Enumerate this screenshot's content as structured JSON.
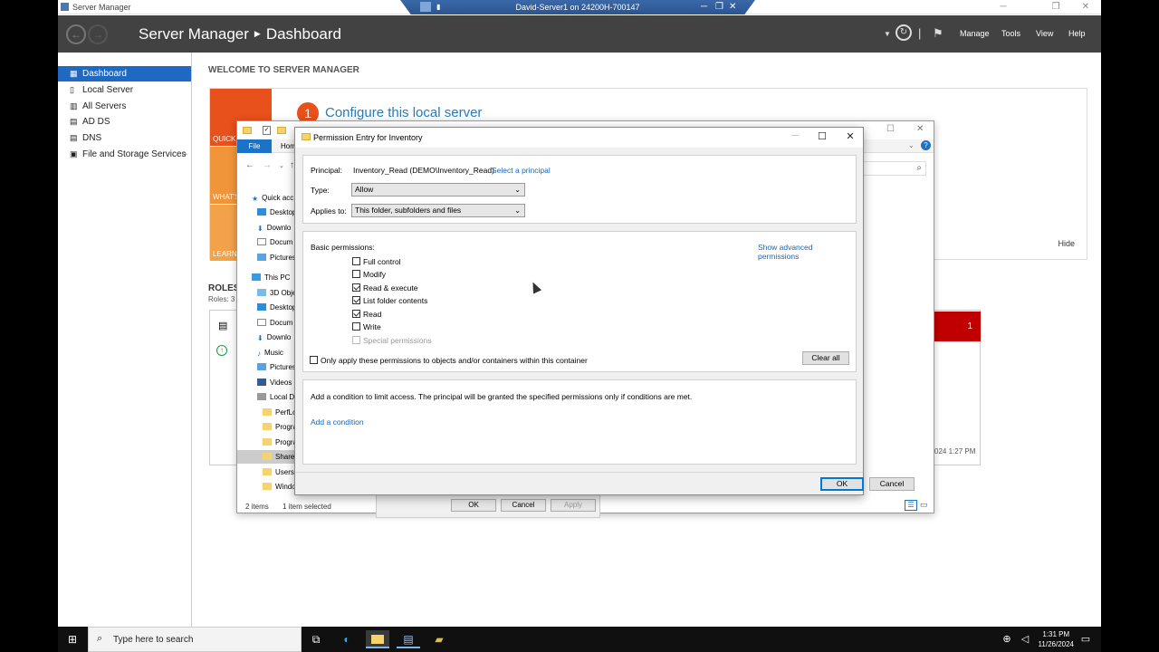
{
  "window": {
    "title": "Server Manager"
  },
  "rdp": {
    "title": "David-Server1 on 24200H-700147"
  },
  "header": {
    "app": "Server Manager",
    "page": "Dashboard",
    "menu": [
      "Manage",
      "Tools",
      "View",
      "Help"
    ]
  },
  "sidebar": {
    "items": [
      {
        "label": "Dashboard",
        "icon": "dashboard-icon"
      },
      {
        "label": "Local Server",
        "icon": "server-icon"
      },
      {
        "label": "All Servers",
        "icon": "servers-icon"
      },
      {
        "label": "AD DS",
        "icon": "ad-ds-icon"
      },
      {
        "label": "DNS",
        "icon": "dns-icon"
      },
      {
        "label": "File and Storage Services",
        "icon": "storage-icon"
      }
    ]
  },
  "dashboard": {
    "welcome": "WELCOME TO SERVER MANAGER",
    "tiles": [
      "QUICK",
      "WHAT'S",
      "LEARN"
    ],
    "config_number": "1",
    "config_text": "Configure this local server",
    "hide": "Hide",
    "roles_title": "ROLES",
    "roles_sub": "Roles: 3",
    "badge_count": "1",
    "timestamp_fragment": "024 1:27 PM"
  },
  "explorer": {
    "ribbon": {
      "file": "File",
      "home": "Hom"
    },
    "tree": [
      "Quick acc",
      "Desktop",
      "Downlo",
      "Docum",
      "Pictures",
      "This PC",
      "3D Objec",
      "Desktop",
      "Docum",
      "Downlo",
      "Music",
      "Pictures",
      "Videos",
      "Local Di",
      "PerfLo",
      "Progra",
      "Progra",
      "Shared",
      "Users",
      "Windo"
    ],
    "status_items": "2 items",
    "status_selected": "1 item selected",
    "buttons": {
      "ok": "OK",
      "cancel": "Cancel",
      "apply": "Apply"
    }
  },
  "permission_entry": {
    "title": "Permission Entry for Inventory",
    "principal_label": "Principal:",
    "principal_value": "Inventory_Read (DEMO\\Inventory_Read)",
    "select_principal": "Select a principal",
    "type_label": "Type:",
    "type_value": "Allow",
    "applies_label": "Applies to:",
    "applies_value": "This folder, subfolders and files",
    "basic_label": "Basic permissions:",
    "show_advanced": "Show advanced permissions",
    "permissions": [
      {
        "label": "Full control",
        "checked": false,
        "disabled": false
      },
      {
        "label": "Modify",
        "checked": false,
        "disabled": false
      },
      {
        "label": "Read & execute",
        "checked": true,
        "disabled": false
      },
      {
        "label": "List folder contents",
        "checked": true,
        "disabled": false
      },
      {
        "label": "Read",
        "checked": true,
        "disabled": false
      },
      {
        "label": "Write",
        "checked": false,
        "disabled": false
      },
      {
        "label": "Special permissions",
        "checked": false,
        "disabled": true
      }
    ],
    "only_apply": "Only apply these permissions to objects and/or containers within this container",
    "clear_all": "Clear all",
    "condition_text": "Add a condition to limit access. The principal will be granted the specified permissions only if conditions are met.",
    "add_condition": "Add a condition",
    "ok": "OK",
    "cancel": "Cancel"
  },
  "taskbar": {
    "search_placeholder": "Type here to search",
    "time": "1:31 PM",
    "date": "11/26/2024"
  },
  "colors": {
    "accent": "#1f69c3",
    "header": "#424242",
    "orange": "#e8501c",
    "link": "#1a65b5",
    "alert": "#c00000"
  }
}
